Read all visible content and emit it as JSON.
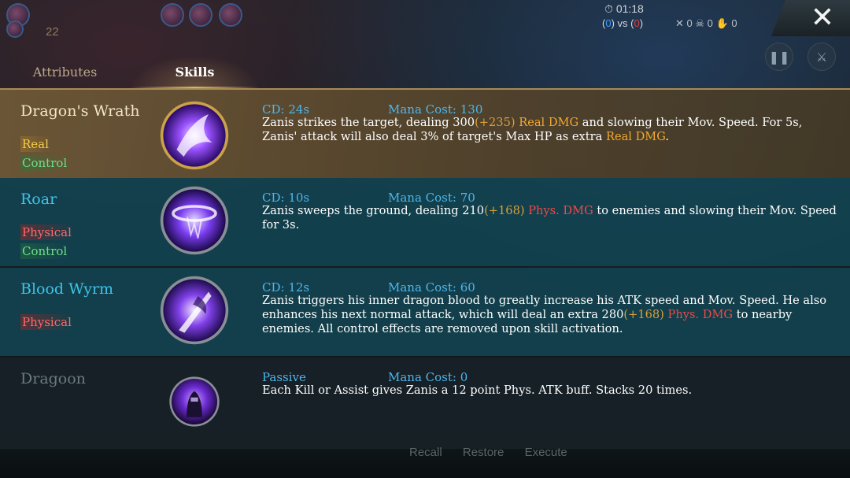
{
  "hud": {
    "kills": "22",
    "timer": "01:18",
    "score_blue": "0",
    "score_vs": "vs",
    "score_red": "0",
    "stat_kills": "0",
    "stat_deaths": "0",
    "stat_assists": "0"
  },
  "tabs": [
    "Attributes",
    "Skills"
  ],
  "active_tab": "Skills",
  "close_label": "✕",
  "skills": [
    {
      "name": "Dragon's Wrath",
      "tags": [
        "Real",
        "Control"
      ],
      "cd": "CD: 24s",
      "mana": "Mana Cost: 130",
      "icon": "dragons-wrath-icon",
      "desc": [
        {
          "t": "Zanis strikes the target, dealing 300"
        },
        {
          "t": "(+235)",
          "c": "scaling"
        },
        {
          "t": " "
        },
        {
          "t": "Real DMG",
          "c": "gold"
        },
        {
          "t": " and slowing their Mov. Speed. For 5s, Zanis' attack will also deal 3% of target's Max HP as extra "
        },
        {
          "t": "Real DMG",
          "c": "gold"
        },
        {
          "t": "."
        }
      ]
    },
    {
      "name": "Roar",
      "tags": [
        "Physical",
        "Control"
      ],
      "cd": "CD: 10s",
      "mana": "Mana Cost: 70",
      "icon": "roar-icon",
      "desc": [
        {
          "t": "Zanis sweeps the ground, dealing 210"
        },
        {
          "t": "(+168)",
          "c": "scaling"
        },
        {
          "t": " "
        },
        {
          "t": "Phys. DMG",
          "c": "red"
        },
        {
          "t": " to enemies and slowing their Mov. Speed for 3s."
        }
      ]
    },
    {
      "name": "Blood Wyrm",
      "tags": [
        "Physical"
      ],
      "cd": "CD: 12s",
      "mana": "Mana Cost: 60",
      "icon": "blood-wyrm-icon",
      "desc": [
        {
          "t": "Zanis triggers his inner dragon blood to greatly increase his ATK speed and Mov. Speed. He also enhances his next normal attack, which will deal an extra 280"
        },
        {
          "t": "(+168)",
          "c": "scaling"
        },
        {
          "t": " "
        },
        {
          "t": "Phys. DMG",
          "c": "red"
        },
        {
          "t": " to nearby enemies. All control effects are removed upon skill activation."
        }
      ]
    },
    {
      "name": "Dragoon",
      "tags": [],
      "cd": "Passive",
      "mana": "Mana Cost: 0",
      "icon": "dragoon-icon",
      "desc": [
        {
          "t": "Each Kill or Assist gives Zanis a 12 point Phys. ATK buff. Stacks 20 times."
        }
      ]
    }
  ],
  "bottom_buttons": [
    "Recall",
    "Restore",
    "Execute"
  ],
  "colors": {
    "cd_mana": "#4fb6ec",
    "scaling": "#d9a13a",
    "real_dmg": "#f2a830",
    "phys_dmg": "#ef4a45",
    "tag_real": "#f4cc4a",
    "tag_physical": "#ff6a6a",
    "tag_control": "#6ee08a",
    "skill_name": "#3fc4e8"
  }
}
